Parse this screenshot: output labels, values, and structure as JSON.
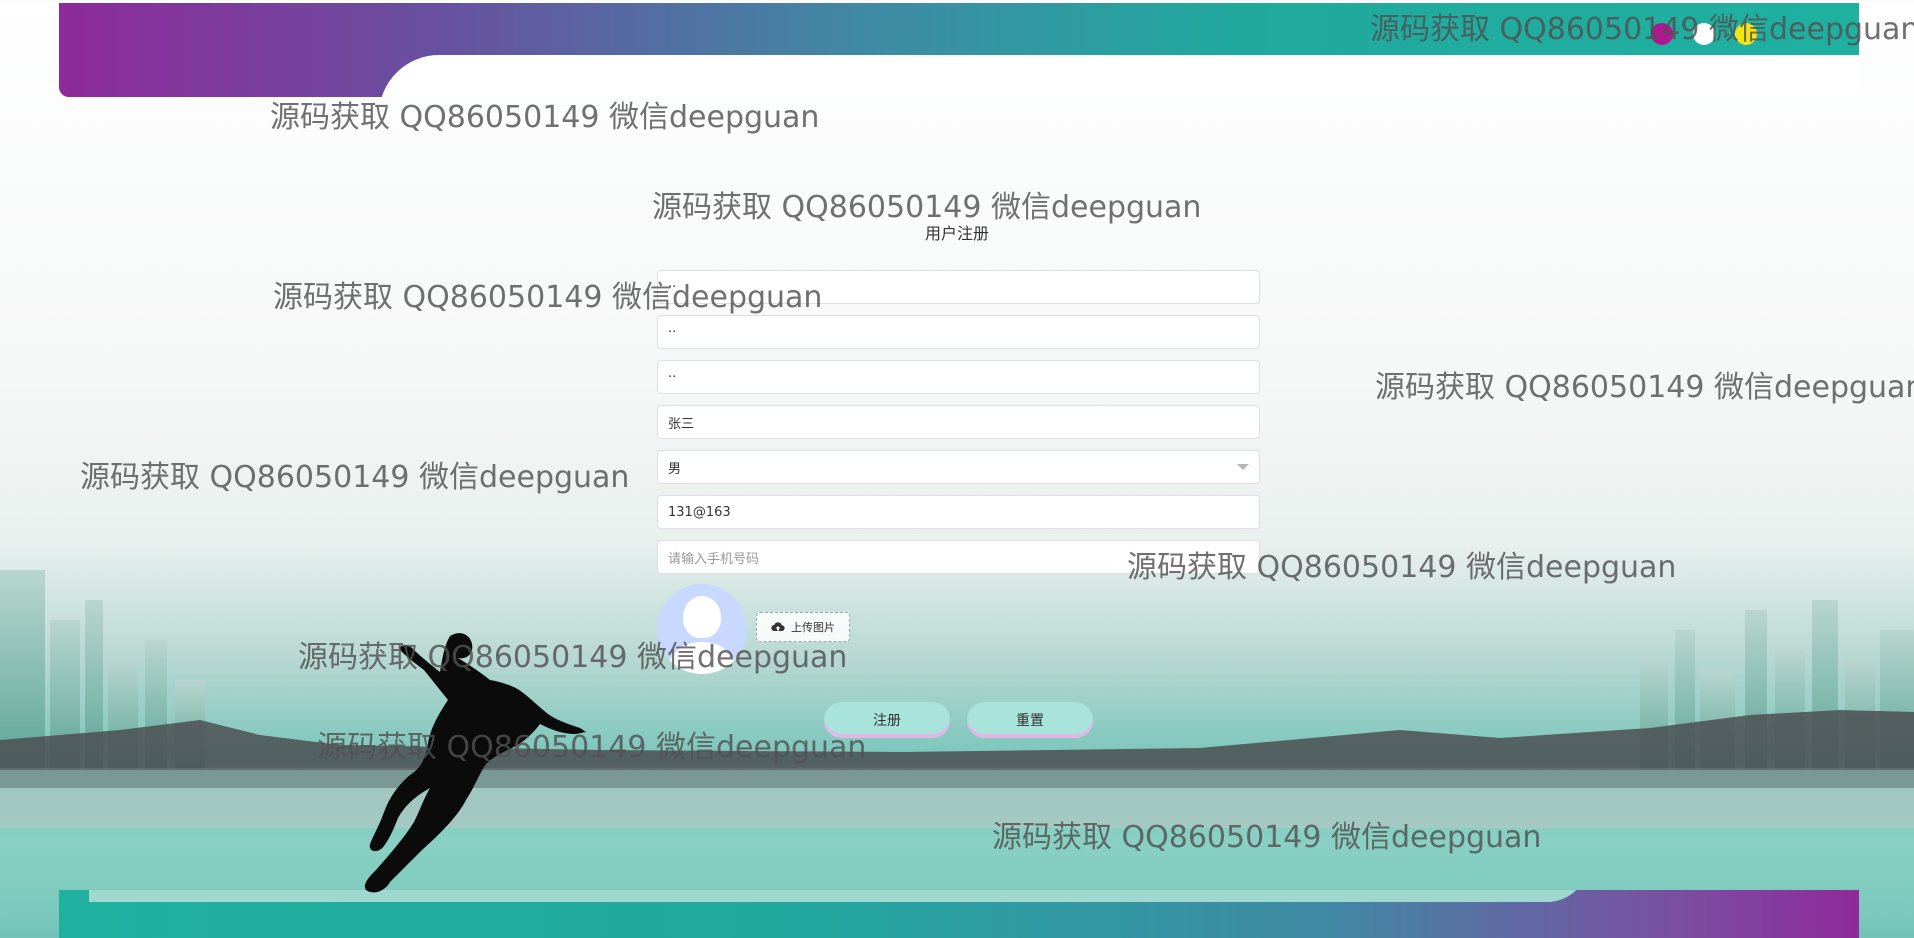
{
  "page": {
    "title": "用户注册"
  },
  "form": {
    "username_value": "··",
    "password_value": "··",
    "confirm_password_value": "··",
    "name_value": "张三",
    "gender_value": "男",
    "email_value": "131@163",
    "phone_placeholder": "请输入手机号码",
    "upload_label": "上传图片",
    "register_label": "注册",
    "reset_label": "重置"
  },
  "watermark": {
    "text": "源码获取 QQ86050149 微信deepguan"
  },
  "colors": {
    "banner_purple": "#8e2a9b",
    "banner_teal": "#1fb0a0",
    "button_bg": "#a8e3dc",
    "avatar_bg": "#c8d8ff"
  },
  "icons": {
    "upload": "cloud-upload-icon",
    "dropdown": "chevron-down-icon",
    "avatar": "user-avatar-icon"
  }
}
